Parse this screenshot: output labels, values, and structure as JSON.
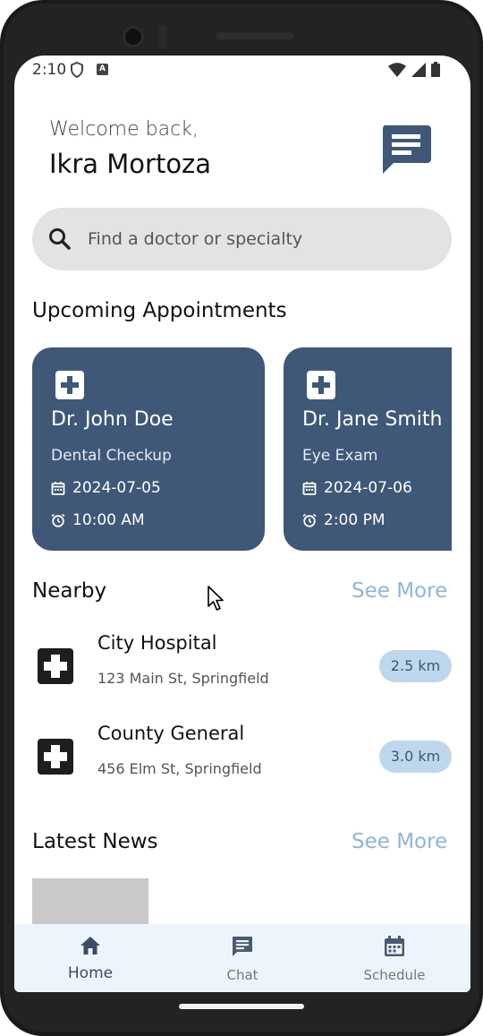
{
  "status_bar": {
    "time": "2:10",
    "a_badge": "A"
  },
  "header": {
    "welcome": "Welcome back,",
    "username": "Ikra Mortoza",
    "chat_icon": "chat-bubble-icon"
  },
  "search": {
    "placeholder": "Find a doctor or specialty",
    "icon": "search-icon"
  },
  "appointments": {
    "title": "Upcoming Appointments",
    "items": [
      {
        "doctor": "Dr. John Doe",
        "type": "Dental Checkup",
        "date": "2024-07-05",
        "time": "10:00 AM"
      },
      {
        "doctor": "Dr. Jane Smith",
        "type": "Eye Exam",
        "date": "2024-07-06",
        "time": "2:00 PM"
      }
    ]
  },
  "nearby": {
    "title": "Nearby",
    "see_more": "See More",
    "items": [
      {
        "name": "City Hospital",
        "address": "123 Main St, Springfield",
        "distance": "2.5 km"
      },
      {
        "name": "County General",
        "address": "456 Elm St, Springfield",
        "distance": "3.0 km"
      }
    ]
  },
  "news": {
    "title": "Latest News",
    "see_more": "See More"
  },
  "bottom_nav": {
    "items": [
      {
        "label": "Home",
        "icon": "home-icon",
        "active": true
      },
      {
        "label": "Chat",
        "icon": "chat-icon",
        "active": false
      },
      {
        "label": "Schedule",
        "icon": "calendar-icon",
        "active": false
      }
    ]
  },
  "colors": {
    "card": "#3f5878",
    "accent_link": "#8fb6d8",
    "distance_pill": "#bed7ed",
    "nav_bg": "#eef4fb"
  }
}
